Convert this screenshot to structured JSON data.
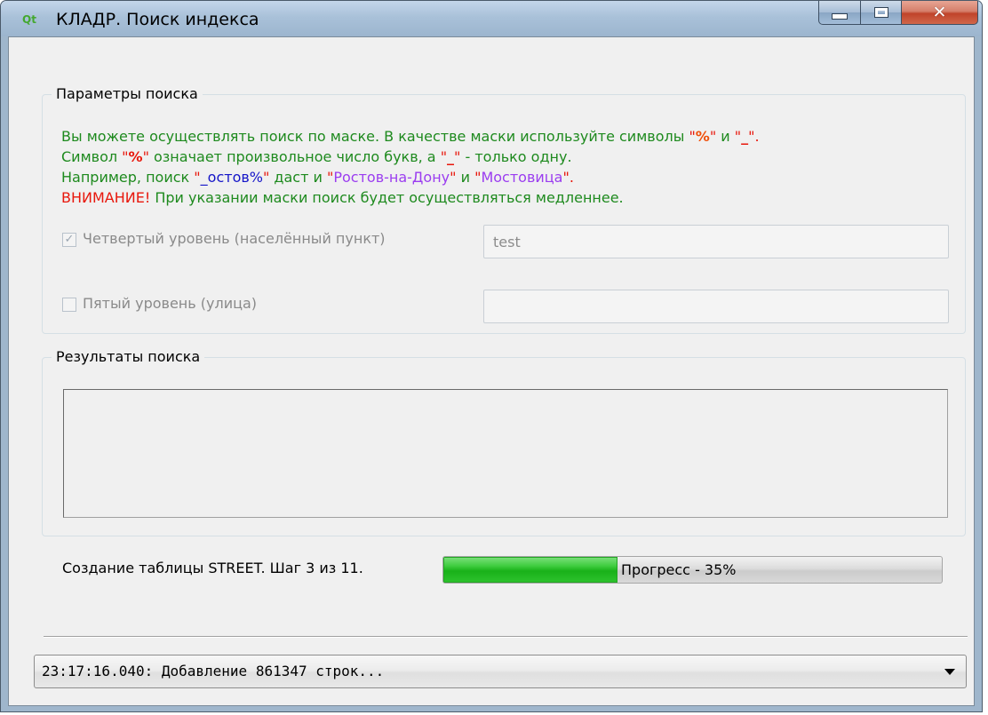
{
  "window": {
    "title": "КЛАДР. Поиск индекса",
    "app_icon": "qt-app-icon",
    "app_icon_text": "Qt"
  },
  "search_params": {
    "group_title": "Параметры поиска",
    "info": {
      "line1_a": "Вы можете осуществлять поиск по маске. В качестве маски используйте символы ",
      "line1_q1": "\"",
      "line1_percent": "%",
      "line1_q2": "\"",
      "line1_b": " и ",
      "line1_q3": "\"",
      "line1_underscore": "_",
      "line1_q4": "\".",
      "line2_a": "Символ ",
      "line2_q1": "\"",
      "line2_percent": "%",
      "line2_q2": "\"",
      "line2_b": " означает произвольное число букв, а ",
      "line2_q3": "\"",
      "line2_underscore": "_",
      "line2_q4": "\"",
      "line2_c": " - только одну.",
      "line3_a": "Например, поиск ",
      "line3_q1": "\"",
      "line3_example": "_остов%",
      "line3_q2": "\"",
      "line3_b": " даст и ",
      "line3_q3": "\"",
      "line3_city1": "Ростов-на-Дону",
      "line3_q4": "\"",
      "line3_c": " и ",
      "line3_q5": "\"",
      "line3_city2": "Мостовица",
      "line3_q6": "\".",
      "line4_warning": "ВНИМАНИЕ!",
      "line4_rest": " При указании маски поиск будет осуществляться медленнее."
    },
    "level4": {
      "checked": true,
      "check_mark": "✓",
      "label": "Четвертый уровень (населённый пункт)",
      "value": "test"
    },
    "level5": {
      "checked": false,
      "label": "Пятый уровень (улица)",
      "value": ""
    }
  },
  "search_results": {
    "group_title": "Результаты поиска"
  },
  "status": {
    "text": "Создание таблицы STREET. Шаг 3 из 11.",
    "progress_percent": 35,
    "progress_label": "Прогресс - 35%"
  },
  "log": {
    "current": "23:17:16.040: Добавление 861347 строк..."
  },
  "colors": {
    "hint_green": "#1e8a1e",
    "mask_red": "#e8170c",
    "example_blue": "#1414c8",
    "city_violet": "#9b3df0",
    "progress_green": "#19b119"
  }
}
